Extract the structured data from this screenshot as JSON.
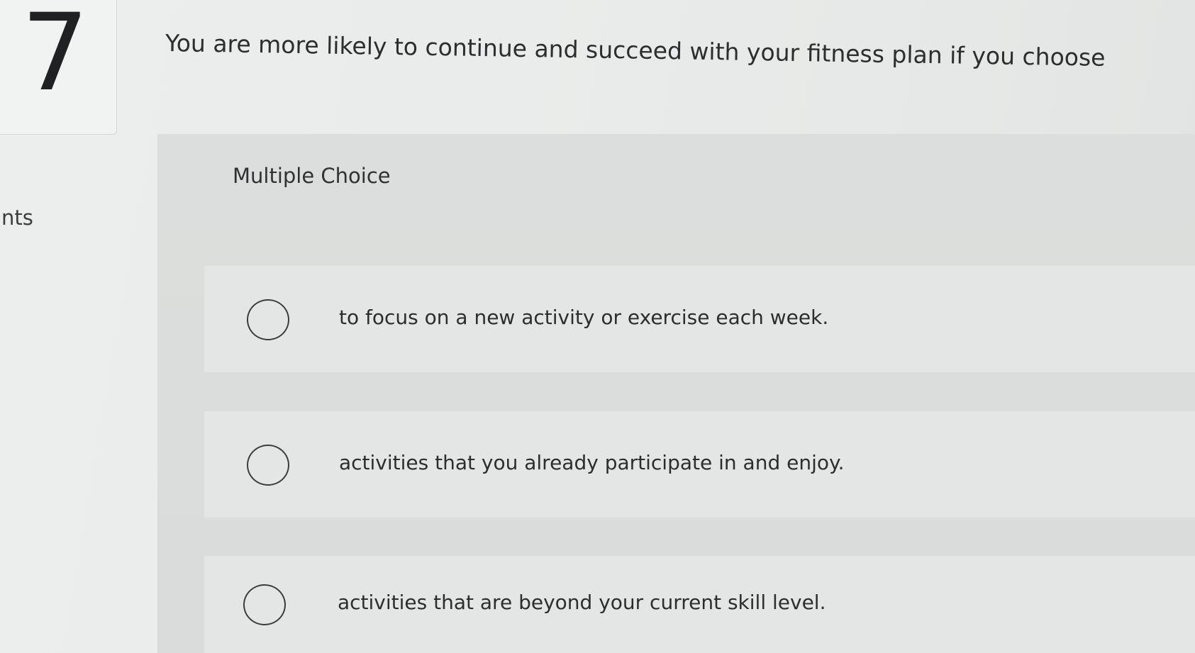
{
  "question": {
    "number": "7",
    "points_label": "ints",
    "prompt": "You are more likely to continue and succeed with your fitness plan if you choose"
  },
  "panel": {
    "heading": "Multiple Choice",
    "options": [
      {
        "label": "to focus on a new activity or exercise each week."
      },
      {
        "label": "activities that you already participate in and enjoy."
      },
      {
        "label": "activities that are beyond your current skill level."
      }
    ]
  }
}
